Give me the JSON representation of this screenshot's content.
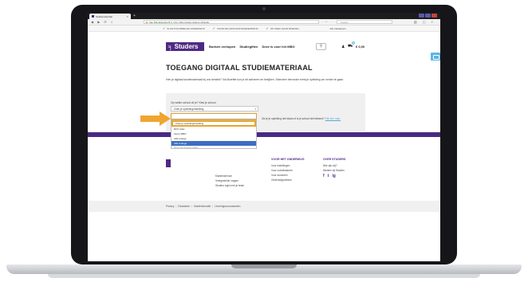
{
  "browser": {
    "tab_title": "Studiemateriaal",
    "url_secure": "Van Dijk Educatie B.V. (NL)",
    "url": "https://www.studers.nl/studie",
    "search_placeholder": "Zoeken",
    "bookmarks": [
      "KLANTVOORDELEN ONDERWIJS",
      "VOOR DE HOOGSTE BOEKENPRIJS",
      "OP ZOEK NAAR BOEKEN"
    ],
    "bookmarks_more": "Alle bladwijzers"
  },
  "site": {
    "logo_text": "Studers",
    "nav": [
      "Boeken verkopen",
      "Studiegiften",
      "Deze is voor het MBO"
    ],
    "cart_count": "0",
    "cart_price": "€ 0,00"
  },
  "content": {
    "title": "TOEGANG DIGITAAL STUDIEMATERIAAL",
    "intro": "Heb je digitaal studiemateriaal bij ons besteld? Via Bureflet kun je dit activeren en bekijken. Selecteer hieronder eerst je opleiding om verder te gaan.",
    "form_label": "Op welke school zit je? Kies je school",
    "select_value": "Zoek je opleiding/instelling",
    "help_text": "Zie je je opleiding niet staan of is je school niet bekend?",
    "help_link": "Klik hier naar.",
    "dropdown_items": [
      "Zoek je opleiding/instelling",
      "ROC Adel",
      "Aeres MBO",
      "Alfa-college",
      "Alfa College",
      "ROC De Groene Welle"
    ],
    "selected_index": 4
  },
  "footer": {
    "col1": [
      "Klantenservice",
      "Veelgestelde vragen",
      "Studers login met je team"
    ],
    "col2_title": "VOOR HET ONDERWIJS",
    "col2": [
      "Voor instellingen",
      "Voor coördinatoren",
      "Voor docenten",
      "Onderwijspartners"
    ],
    "col3_title": "OVER STUDERS",
    "col3": [
      "Wie zijn wij?",
      "Werken bij Studers"
    ],
    "socials": [
      "f",
      "t",
      "ig"
    ],
    "bottom_links": [
      "Privacy",
      "Disclaimer",
      "Klantinformatie",
      "Leveringsvoorwaarden"
    ]
  },
  "colors": {
    "brand_purple": "#4e2a84",
    "accent_orange": "#e9a52b",
    "selected_blue": "#3d6ec2",
    "chat_blue": "#5bb6e5"
  }
}
